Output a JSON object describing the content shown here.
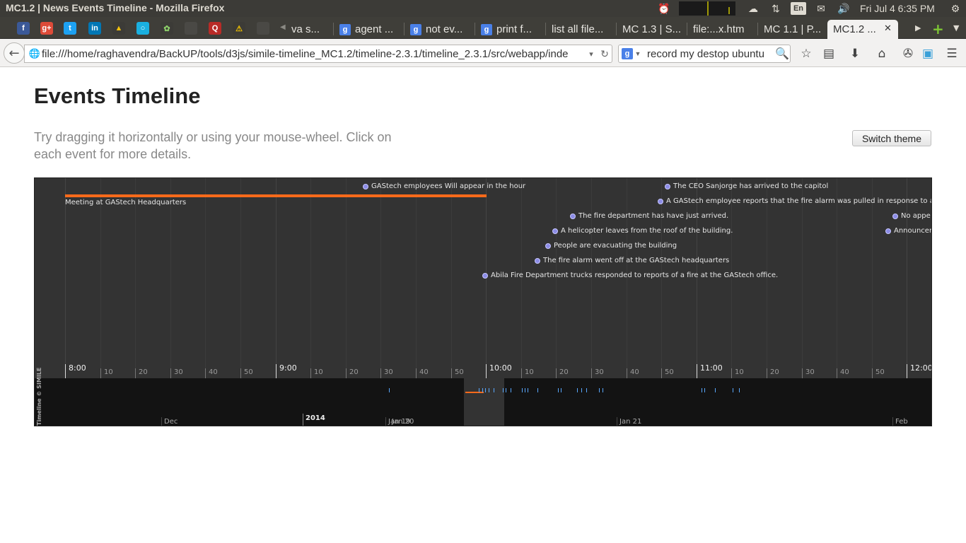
{
  "os": {
    "window_title": "MC1.2 | News Events Timeline - Mozilla Firefox",
    "keyboard_layout": "En",
    "clock": "Fri Jul 4  6:35 PM"
  },
  "tabs": [
    {
      "label": "va s..."
    },
    {
      "label": "agent ..."
    },
    {
      "label": "not ev..."
    },
    {
      "label": "print f..."
    },
    {
      "label": "list all file..."
    },
    {
      "label": "MC 1.3 | S..."
    },
    {
      "label": "file:...x.htm"
    },
    {
      "label": "MC 1.1 | P..."
    },
    {
      "label": "MC1.2 ..."
    }
  ],
  "nav": {
    "url": "file:///home/raghavendra/BackUP/tools/d3js/simile-timeline_MC1.2/timeline-2.3.1/timeline_2.3.1/src/webapp/inde",
    "search_value": "record my destop ubuntu"
  },
  "page": {
    "title": "Events Timeline",
    "intro": "Try dragging it horizontally or using your mouse-wheel. Click on each event for more details.",
    "switch_theme_label": "Switch theme"
  },
  "timeline": {
    "duration_event": "Meeting at GAStech Headquarters",
    "events": [
      "GAStech employees Will appear in the hour",
      "The CEO Sanjorge has arrived to the capitol",
      "A GAStech employee reports that the fire alarm was pulled in response to a bor",
      "The fire department has have just arrived.",
      "No appe",
      "A helicopter leaves from the roof of the building.",
      "Announcer",
      "People are evacuating the building",
      "The fire alarm went off at the GAStech headquarters",
      "Abila Fire Department trucks responded to reports of a fire at the GAStech office."
    ],
    "ruler_labels": [
      "8:00",
      "10",
      "20",
      "30",
      "40",
      "50",
      "9:00",
      "10",
      "20",
      "30",
      "40",
      "50",
      "10:00",
      "10",
      "20",
      "30",
      "40",
      "50",
      "11:00",
      "10",
      "20",
      "30",
      "40",
      "50",
      "12:00"
    ],
    "overview_labels": [
      "Dec",
      "2014",
      "Jan 19",
      "Jan 20",
      "Jan 21",
      "Feb"
    ],
    "copyright": "Timeline © SIMILE"
  }
}
